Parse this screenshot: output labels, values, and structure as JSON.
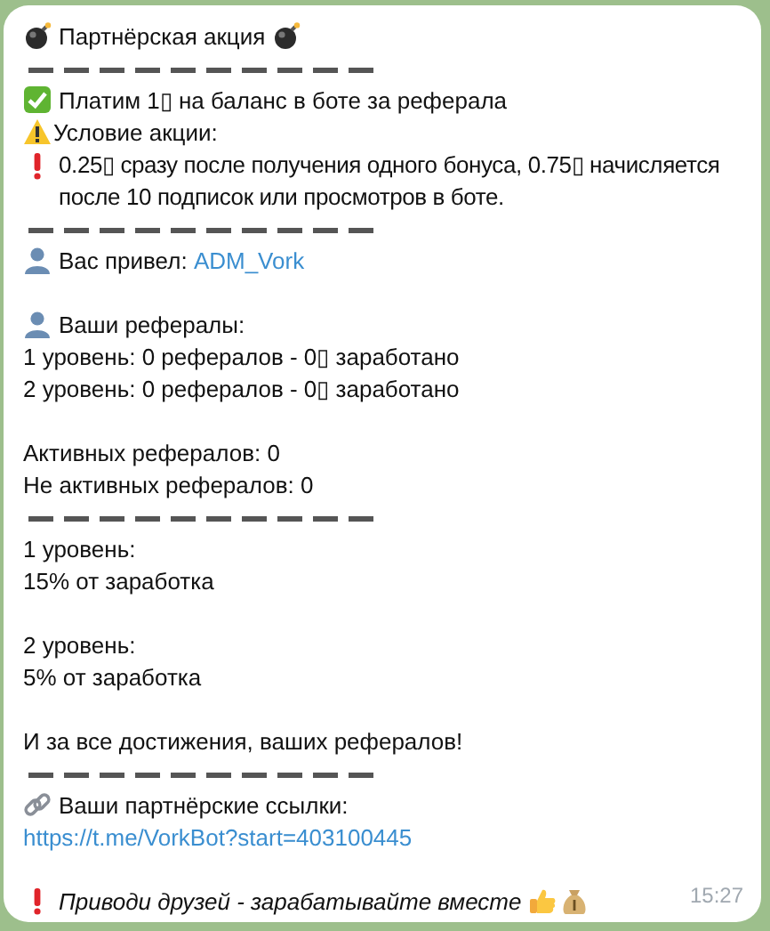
{
  "message": {
    "title": "Партнёрская акция",
    "offer": "Платим 1▯ на баланс в боте за реферала",
    "condition_heading": "Условие акции:",
    "condition_text": "0.25▯ сразу после получения одного бонуса, 0.75▯ начисляется после 10 подписок или просмотров в боте.",
    "referrer_label": "Вас привел:",
    "referrer_link": "ADM_Vork",
    "referrals_heading": "Ваши рефералы:",
    "referral_levels": [
      "1 уровень: 0 рефералов - 0▯ заработано",
      "2 уровень: 0 рефералов - 0▯ заработано"
    ],
    "active": "Активных рефералов: 0",
    "inactive": "Не активных рефералов: 0",
    "level_rewards": [
      {
        "level": "1 уровень:",
        "share": "15% от заработка"
      },
      {
        "level": "2 уровень:",
        "share": "5% от заработка"
      }
    ],
    "closing": "И за все достижения, ваших рефералов!",
    "links_heading": "Ваши партнёрские ссылки:",
    "link": "https://t.me/VorkBot?start=403100445",
    "footer": "Приводи друзей - зарабатывайте вместе",
    "time": "15:27"
  }
}
